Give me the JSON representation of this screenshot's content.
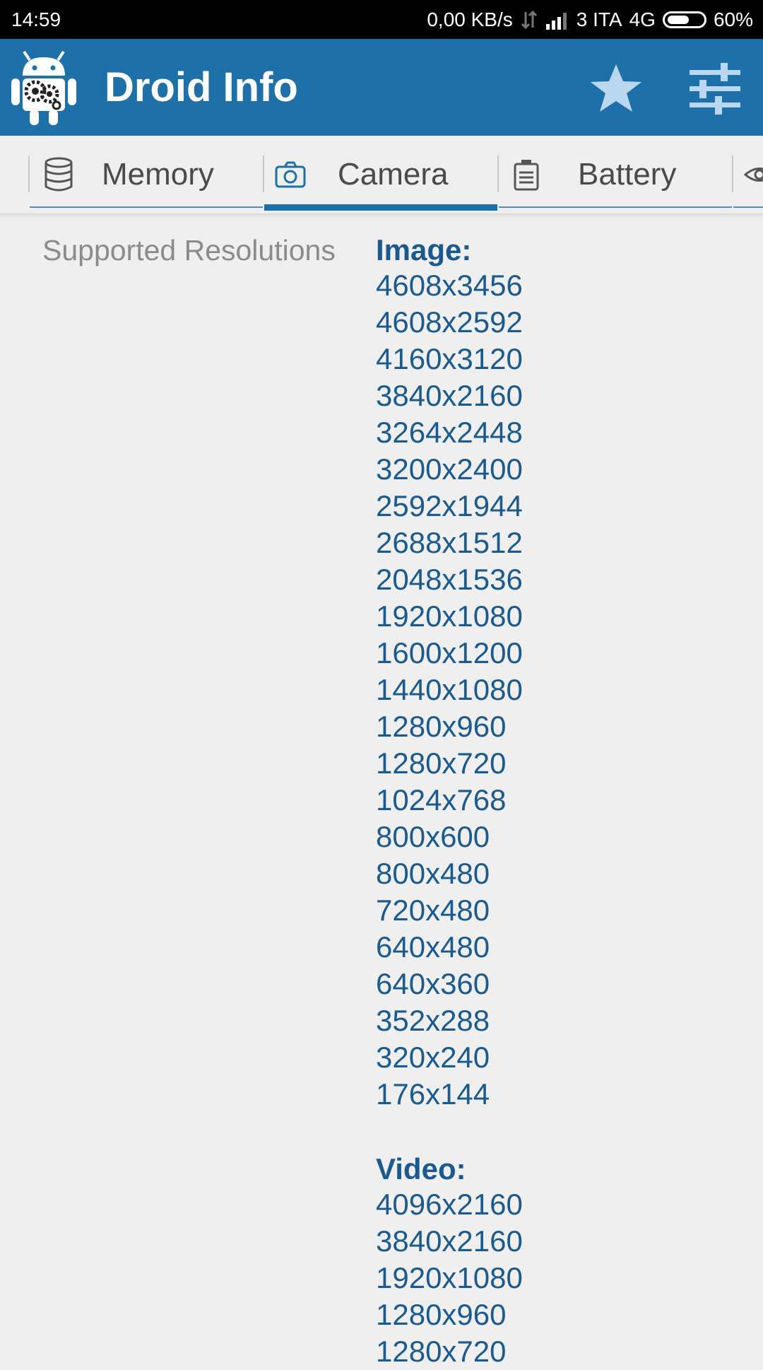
{
  "status_bar": {
    "time": "14:59",
    "network_speed": "0,00 KB/s",
    "carrier": "3 ITA",
    "network_type": "4G",
    "battery": "60%"
  },
  "app_bar": {
    "title": "Droid Info",
    "icons": [
      "android-gears-logo-icon",
      "star-icon",
      "tune-sliders-icon"
    ]
  },
  "tabs": [
    {
      "label": "Memory",
      "icon": "database-icon",
      "active": false
    },
    {
      "label": "Camera",
      "icon": "camera-icon",
      "active": true
    },
    {
      "label": "Battery",
      "icon": "battery-icon",
      "active": false
    }
  ],
  "content": {
    "label": "Supported Resolutions",
    "image_heading": "Image:",
    "image_resolutions": [
      "4608x3456",
      "4608x2592",
      "4160x3120",
      "3840x2160",
      "3264x2448",
      "3200x2400",
      "2592x1944",
      "2688x1512",
      "2048x1536",
      "1920x1080",
      "1600x1200",
      "1440x1080",
      "1280x960",
      "1280x720",
      "1024x768",
      "800x600",
      "800x480",
      "720x480",
      "640x480",
      "640x360",
      "352x288",
      "320x240",
      "176x144"
    ],
    "video_heading": "Video:",
    "video_resolutions": [
      "4096x2160",
      "3840x2160",
      "1920x1080",
      "1280x960",
      "1280x720"
    ]
  },
  "colors": {
    "app_bar": "#1d71a8",
    "accent": "#1d71a8",
    "value_text": "#1a5a8e",
    "label_text": "#8b8b8b",
    "background": "#efeff0"
  }
}
